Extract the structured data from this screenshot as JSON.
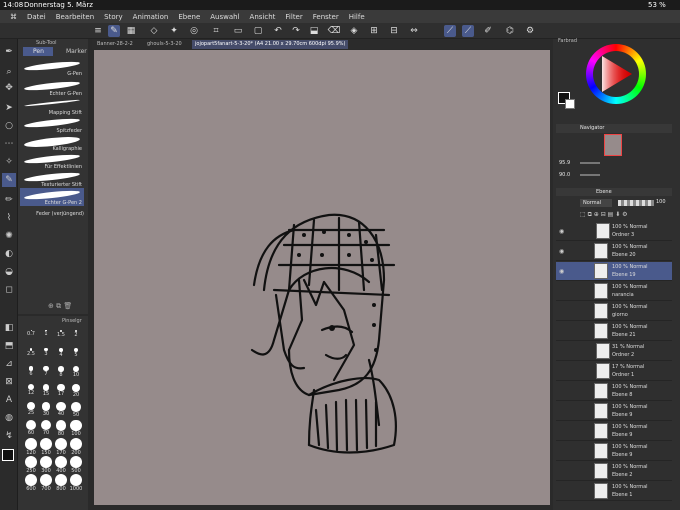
{
  "status": {
    "time": "14:08",
    "date": "Donnerstag 5. März",
    "battery": "53 %"
  },
  "menu": [
    "Datei",
    "Bearbeiten",
    "Story",
    "Animation",
    "Ebene",
    "Auswahl",
    "Ansicht",
    "Filter",
    "Fenster",
    "Hilfe"
  ],
  "tabs": [
    "Banner-28-2-2",
    "ghouls-5-3-20",
    "jojopart5fanart-5-3-20* (A4 21.00 x 29.70cm 600dpi 95.9%)"
  ],
  "subtool": {
    "header": "Sub-Tool",
    "pen_tab": "Pen",
    "marker_tab": "Marker",
    "items": [
      "G-Pen",
      "Echter G-Pen",
      "Mapping Stift",
      "Spitzfeder",
      "Kalligraphie",
      "Für Effektlinien",
      "Texturierter Stift",
      "Echter G-Pen 2",
      "Feder (verjüngend)"
    ]
  },
  "brush": {
    "header": "Pinselgr",
    "sizes": [
      "0.7",
      "1",
      "1.5",
      "2",
      "2.5",
      "3",
      "4",
      "5",
      "6",
      "7",
      "8",
      "10",
      "12",
      "15",
      "17",
      "20",
      "25",
      "30",
      "40",
      "50",
      "60",
      "70",
      "80",
      "100",
      "120",
      "150",
      "170",
      "200",
      "250",
      "300",
      "400",
      "500",
      "600",
      "700",
      "800",
      "1000"
    ]
  },
  "color_wheel": {
    "header": "Farbrad"
  },
  "navigator": {
    "header": "Navigator",
    "zoom": "95.9",
    "rotate": "90.0"
  },
  "layers": {
    "header": "Ebene",
    "blend": "Normal",
    "opacity": "100",
    "items": [
      {
        "l1": "100 % Normal",
        "l2": "Ordner 3"
      },
      {
        "l1": "100 % Normal",
        "l2": "Ebene 20"
      },
      {
        "l1": "100 % Normal",
        "l2": "Ebene 19"
      },
      {
        "l1": "100 % Normal",
        "l2": "narancia"
      },
      {
        "l1": "100 % Normal",
        "l2": "giorno"
      },
      {
        "l1": "100 % Normal",
        "l2": "Ebene 21"
      },
      {
        "l1": "31 % Normal",
        "l2": "Ordner 2"
      },
      {
        "l1": "17 % Normal",
        "l2": "Ordner 1"
      },
      {
        "l1": "100 % Normal",
        "l2": "Ebene 8"
      },
      {
        "l1": "100 % Normal",
        "l2": "Ebene 9"
      },
      {
        "l1": "100 % Normal",
        "l2": "Ebene 9"
      },
      {
        "l1": "100 % Normal",
        "l2": "Ebene 9"
      },
      {
        "l1": "100 % Normal",
        "l2": "Ebene 2"
      },
      {
        "l1": "100 % Normal",
        "l2": "Ebene 1"
      }
    ]
  }
}
